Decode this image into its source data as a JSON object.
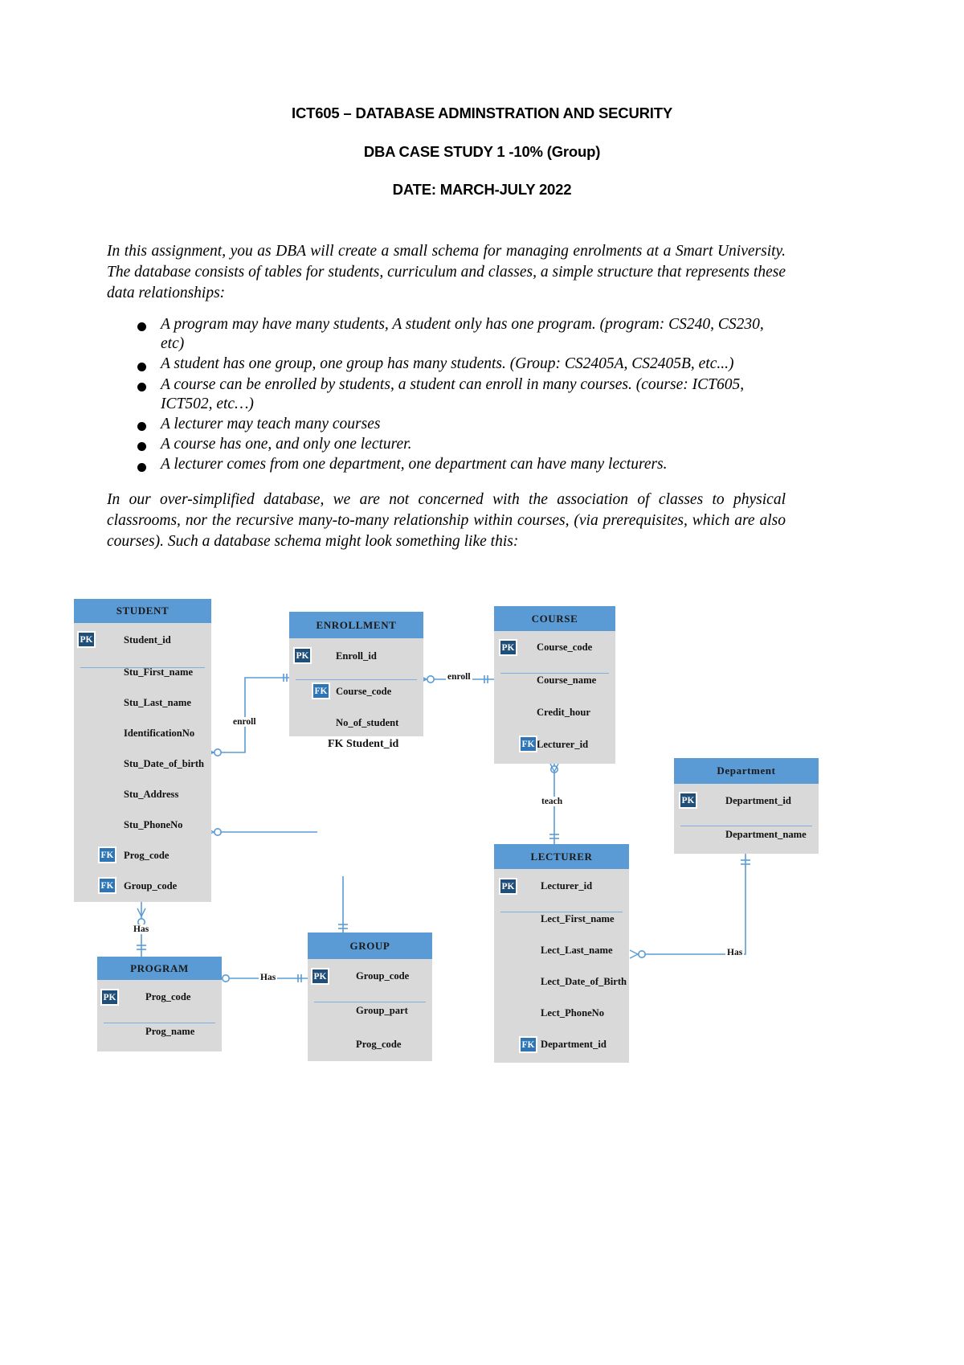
{
  "document": {
    "headings": [
      "ICT605 – DATABASE ADMINSTRATION AND SECURITY",
      "DBA CASE STUDY 1 -10% (Group)",
      "DATE: MARCH-JULY 2022"
    ],
    "intro_paragraph": "In this assignment, you as DBA will create a small schema for managing enrolments at a Smart University.  The database consists of tables for students, curriculum and classes, a simple structure that represents these data relationships:",
    "bullets": [
      "A program may have many students, A student only has one program. (program: CS240, CS230, etc)",
      "A student has one group, one group has many students. (Group: CS2405A, CS2405B, etc...)",
      "A course can be enrolled by students, a student can enroll in many courses. (course: ICT605, ICT502, etc…)",
      "A lecturer may teach many courses",
      "A course has one, and only one lecturer.",
      "A lecturer comes from one department, one department can have many lecturers."
    ],
    "outro_paragraph": "In our over-simplified database, we are not concerned with the association of classes to physical classrooms, nor the recursive many-to-many relationship within courses, (via prerequisites, which are also courses).   Such a database schema might look something like this:"
  },
  "diagram": {
    "colors": {
      "header": "#5b9bd5",
      "body": "#d9d9d9",
      "pk_badge": "#1f4e79",
      "fk_badge": "#2e75b6",
      "connector": "#5b9bd5"
    },
    "key_labels": {
      "pk": "PK",
      "fk": "FK"
    },
    "entities": [
      {
        "id": "student",
        "title": "STUDENT",
        "attributes": [
          {
            "key": "PK",
            "name": "Student_id"
          },
          {
            "key": "",
            "name": "Stu_First_name"
          },
          {
            "key": "",
            "name": "Stu_Last_name"
          },
          {
            "key": "",
            "name": "IdentificationNo"
          },
          {
            "key": "",
            "name": "Stu_Date_of_birth"
          },
          {
            "key": "",
            "name": "Stu_Address"
          },
          {
            "key": "",
            "name": "Stu_PhoneNo"
          },
          {
            "key": "FK",
            "name": "Prog_code"
          },
          {
            "key": "FK",
            "name": "Group_code"
          }
        ]
      },
      {
        "id": "enrollment",
        "title": "ENROLLMENT",
        "attributes": [
          {
            "key": "PK",
            "name": "Enroll_id"
          },
          {
            "key": "FK",
            "name": "Course_code"
          },
          {
            "key": "",
            "name": "No_of_student"
          }
        ]
      },
      {
        "id": "course",
        "title": "COURSE",
        "attributes": [
          {
            "key": "PK",
            "name": "Course_code"
          },
          {
            "key": "",
            "name": "Course_name"
          },
          {
            "key": "",
            "name": "Credit_hour"
          },
          {
            "key": "FK",
            "name": "Lecturer_id"
          }
        ]
      },
      {
        "id": "department",
        "title": "Department",
        "attributes": [
          {
            "key": "PK",
            "name": "Department_id"
          },
          {
            "key": "",
            "name": "Department_name"
          }
        ]
      },
      {
        "id": "lecturer",
        "title": "LECTURER",
        "attributes": [
          {
            "key": "PK",
            "name": "Lecturer_id"
          },
          {
            "key": "",
            "name": "Lect_First_name"
          },
          {
            "key": "",
            "name": "Lect_Last_name"
          },
          {
            "key": "",
            "name": "Lect_Date_of_Birth"
          },
          {
            "key": "",
            "name": "Lect_PhoneNo"
          },
          {
            "key": "FK",
            "name": "Department_id"
          }
        ]
      },
      {
        "id": "program",
        "title": "PROGRAM",
        "attributes": [
          {
            "key": "PK",
            "name": "Prog_code"
          },
          {
            "key": "",
            "name": "Prog_name"
          }
        ]
      },
      {
        "id": "group",
        "title": "GROUP",
        "attributes": [
          {
            "key": "PK",
            "name": "Group_code"
          },
          {
            "key": "",
            "name": "Group_part"
          },
          {
            "key": "",
            "name": "Prog_code"
          }
        ]
      }
    ],
    "relationship_labels": {
      "student_enrollment": "enroll",
      "enrollment_course": "enroll",
      "course_lecturer": "teach",
      "student_program": "Has",
      "program_group": "Has",
      "lecturer_department": "Has"
    },
    "floating_labels": {
      "enrollment_student_fk": "FK Student_id"
    }
  }
}
